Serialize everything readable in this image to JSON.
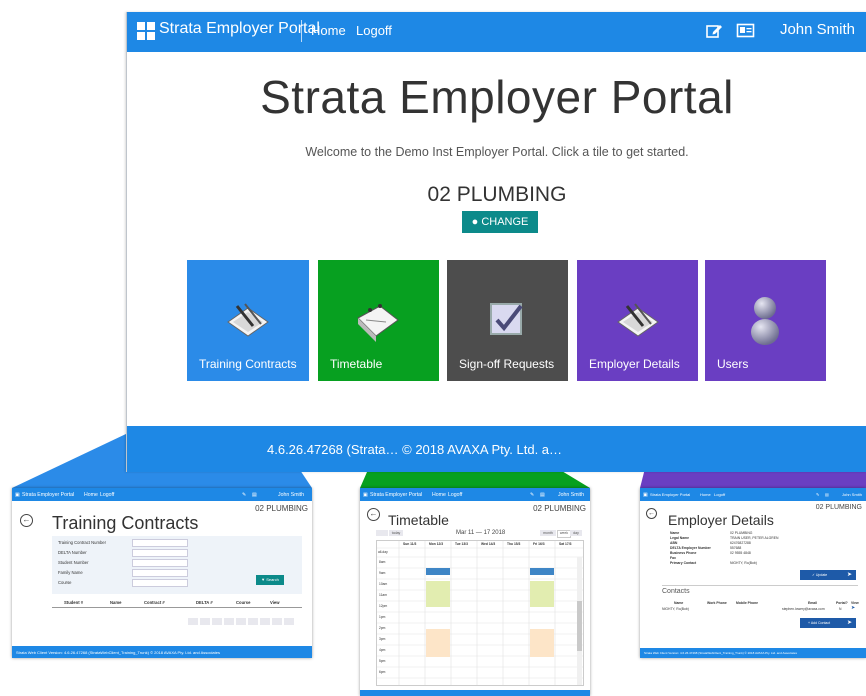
{
  "navbar": {
    "brand": "Strata Employer Portal",
    "home": "Home",
    "logoff": "Logoff",
    "user": "John Smith",
    "icons": [
      "edit-icon",
      "id-card-icon"
    ]
  },
  "hero": {
    "title": "Strata Employer Portal",
    "welcome": "Welcome to the Demo Inst Employer Portal. Click a tile to get started.",
    "org": "02 PLUMBING",
    "change_label": "CHANGE"
  },
  "tiles": [
    {
      "label": "Training Contracts",
      "color": "#2b8be8"
    },
    {
      "label": "Timetable",
      "color": "#07a020"
    },
    {
      "label": "Sign-off Requests",
      "color": "#4d4d4d"
    },
    {
      "label": "Employer Details",
      "color": "#6a3ec2"
    },
    {
      "label": "Users",
      "color": "#6a3ec2"
    }
  ],
  "footer": {
    "text": "4.6.26.47268 (Strata…                                                     © 2018 AVAXA Pty. Ltd. a…"
  },
  "thumb_training": {
    "brand": "Strata Employer Portal",
    "home": "Home",
    "logoff": "Logoff",
    "user": "John Smith",
    "org": "02 PLUMBING",
    "title": "Training Contracts",
    "fields": [
      "Training Contract Number",
      "DELTA Number",
      "Student Number",
      "Family Name",
      "Course"
    ],
    "search_label": "Search",
    "columns": [
      "Student #",
      "Name",
      "Contract #",
      "DELTA #",
      "Course",
      "View"
    ],
    "footer": "Strata Web Client Version: 4.6.26.47268 (StrataWebClient_Training_Trunk) © 2018 AVAXA Pty. Ltd. and Associates"
  },
  "thumb_timetable": {
    "brand": "Strata Employer Portal",
    "home": "Home",
    "logoff": "Logoff",
    "user": "John Smith",
    "org": "02 PLUMBING",
    "title": "Timetable",
    "today": "today",
    "range": "Mar 11 — 17 2018",
    "views": [
      "month",
      "week",
      "day"
    ],
    "days": [
      "Sun 11/3",
      "Mon 12/3",
      "Tue 13/3",
      "Wed 14/3",
      "Thu 15/3",
      "Fri 16/3",
      "Sat 17/3"
    ],
    "allday": "all-day",
    "hours": [
      "8am",
      "9am",
      "10am",
      "11am",
      "12pm",
      "1pm",
      "2pm",
      "3pm",
      "4pm",
      "5pm",
      "6pm",
      "7pm"
    ]
  },
  "thumb_employer": {
    "brand": "Strata Employer Portal",
    "home": "Home",
    "logoff": "Logoff",
    "user": "John Smith",
    "org": "02 PLUMBING",
    "title": "Employer Details",
    "details": [
      {
        "k": "Name",
        "v": "02 PLUMBING"
      },
      {
        "k": "Legal Name",
        "v": "TRAIN USER, PETER ALGREN"
      },
      {
        "k": "ABN",
        "v": "62476827288"
      },
      {
        "k": "DELTA Employer Number",
        "v": "557688"
      },
      {
        "k": "Business Phone",
        "v": "02 9555 4848"
      },
      {
        "k": "Fax",
        "v": ""
      },
      {
        "k": "Primary Contact",
        "v": "NIGHTY, Ro(Bob)"
      }
    ],
    "update_label": "Update",
    "contacts_title": "Contacts",
    "contact_columns": [
      "Name",
      "Work Phone",
      "Mobile Phone",
      "Email",
      "Portal?",
      "View"
    ],
    "contact_row": [
      "NIGHTY, Ro(Bob)",
      "",
      "",
      "stephen.lowery@avaxa.com",
      "N",
      ""
    ],
    "add_contact_label": "Add Contact",
    "footer": "Strata Web Client Version: 4.6.26.47268 (StrataWebClient_Training_Trunk) © 2018 AVAXA Pty. Ltd. and Associates"
  }
}
